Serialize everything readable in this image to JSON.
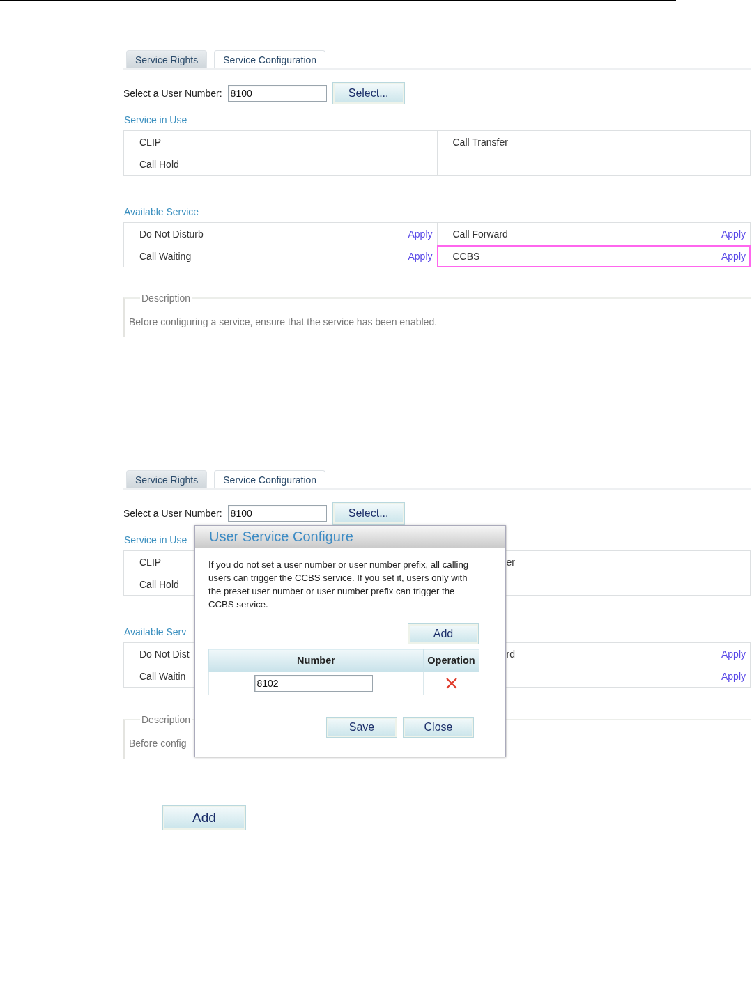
{
  "screens": [
    {
      "tabs": [
        {
          "label": "Service Rights",
          "selected": false
        },
        {
          "label": "Service Configuration",
          "selected": true
        }
      ],
      "user_number_label": "Select a User Number:",
      "user_number": "8100",
      "select_button": "Select...",
      "in_use": {
        "title": "Service in Use",
        "rows": [
          {
            "cells": [
              {
                "name": "CLIP"
              },
              {
                "name": "Call Transfer"
              }
            ]
          },
          {
            "cells": [
              {
                "name": "Call Hold"
              }
            ]
          }
        ]
      },
      "available": {
        "title": "Available Service",
        "rows": [
          {
            "cells": [
              {
                "name": "Do Not Disturb",
                "action": "Apply",
                "highlighted": false
              },
              {
                "name": "Call Forward",
                "action": "Apply",
                "highlighted": false
              }
            ]
          },
          {
            "cells": [
              {
                "name": "Call Waiting",
                "action": "Apply",
                "highlighted": false
              },
              {
                "name": "CCBS",
                "action": "Apply",
                "highlighted": true
              }
            ]
          }
        ]
      },
      "description": {
        "legend": "Description",
        "text": "Before configuring a service, ensure that the service has been enabled."
      }
    },
    {
      "tabs": [
        {
          "label": "Service Rights",
          "selected": false
        },
        {
          "label": "Service Configuration",
          "selected": true
        }
      ],
      "user_number_label": "Select a User Number:",
      "user_number": "8100",
      "select_button": "Select...",
      "in_use": {
        "title": "Service in Use",
        "rows": [
          {
            "cells": [
              {
                "name": "CLIP"
              },
              {
                "name": "er"
              }
            ]
          },
          {
            "cells": [
              {
                "name": "Call Hold"
              }
            ]
          }
        ]
      },
      "available": {
        "title": "Available Serv",
        "rows": [
          {
            "cells": [
              {
                "name": "Do Not Dist",
                "highlighted": false
              },
              {
                "name": "rd",
                "action": "Apply",
                "highlighted": false
              }
            ]
          },
          {
            "cells": [
              {
                "name": "Call Waitin",
                "highlighted": false
              },
              {
                "action": "Apply",
                "highlighted": false
              }
            ]
          }
        ]
      },
      "description": {
        "legend": "Description",
        "text": "Before config"
      },
      "dialog": {
        "title": "User Service Configure",
        "message": "If you do not set a user number or user number prefix, all calling users can trigger the CCBS service. If you set it, users only with the preset user number or user number prefix can trigger the CCBS service.",
        "add_button": "Add",
        "columns": [
          "Number",
          "Operation"
        ],
        "rows": [
          {
            "number": "8102"
          }
        ],
        "buttons": [
          "Save",
          "Close"
        ]
      }
    }
  ],
  "add_button": "Add"
}
